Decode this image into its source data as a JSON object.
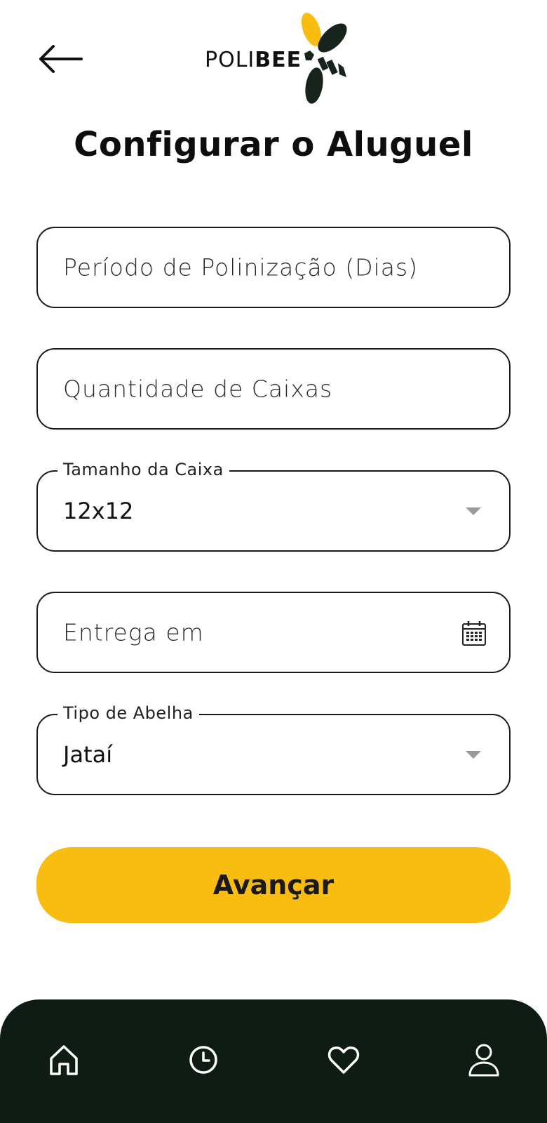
{
  "header": {
    "logo_text_light": "POLI",
    "logo_text_bold": "BEE",
    "back_icon": "arrow-left-icon"
  },
  "page": {
    "title": "Configurar o Aluguel"
  },
  "form": {
    "period": {
      "placeholder": "Período de Polinização (Dias)"
    },
    "quantity": {
      "placeholder": "Quantidade de Caixas"
    },
    "box_size": {
      "label": "Tamanho da Caixa",
      "value": "12x12"
    },
    "delivery": {
      "placeholder": "Entrega em",
      "icon": "calendar-icon"
    },
    "bee_type": {
      "label": "Tipo de Abelha",
      "value": "Jataí"
    },
    "submit_label": "Avançar"
  },
  "nav": {
    "items": [
      {
        "icon": "home-icon"
      },
      {
        "icon": "clock-icon"
      },
      {
        "icon": "heart-icon"
      },
      {
        "icon": "user-icon"
      }
    ]
  },
  "colors": {
    "accent": "#f8bd10",
    "nav_background": "#0e1c14",
    "logo_dark": "#16241c"
  }
}
